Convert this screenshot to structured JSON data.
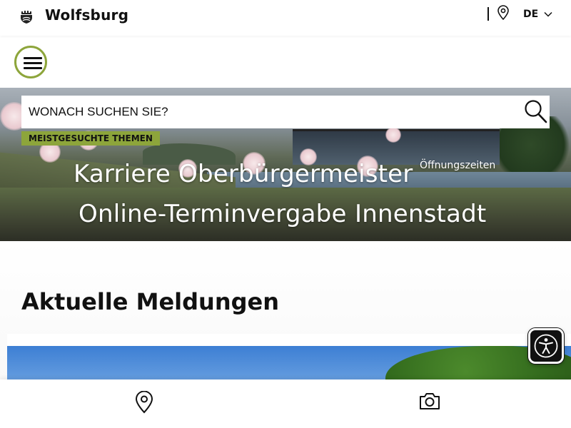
{
  "header": {
    "brand": "Wolfsburg",
    "logo_icon": "city-crest-icon",
    "location_icon": "map-pin-icon",
    "language": "DE",
    "language_icon": "chevron-down-icon"
  },
  "nav": {
    "menu_icon": "hamburger-menu-icon",
    "accent_color": "#8da53b"
  },
  "search": {
    "placeholder": "WONACH SUCHEN SIE?",
    "value": "",
    "icon": "search-icon",
    "top_topics_label": "MEISTGESUCHTE THEMEN",
    "topics": [
      "Karriere",
      "Oberbürgermeister",
      "Öffnungszeiten",
      "Online-Terminvergabe",
      "Innenstadt"
    ]
  },
  "main": {
    "news_heading": "Aktuelle Meldungen"
  },
  "accessibility": {
    "icon": "accessibility-icon"
  },
  "bottom_nav": {
    "items": [
      {
        "icon": "map-pin-icon"
      },
      {
        "icon": "camera-icon"
      }
    ]
  }
}
